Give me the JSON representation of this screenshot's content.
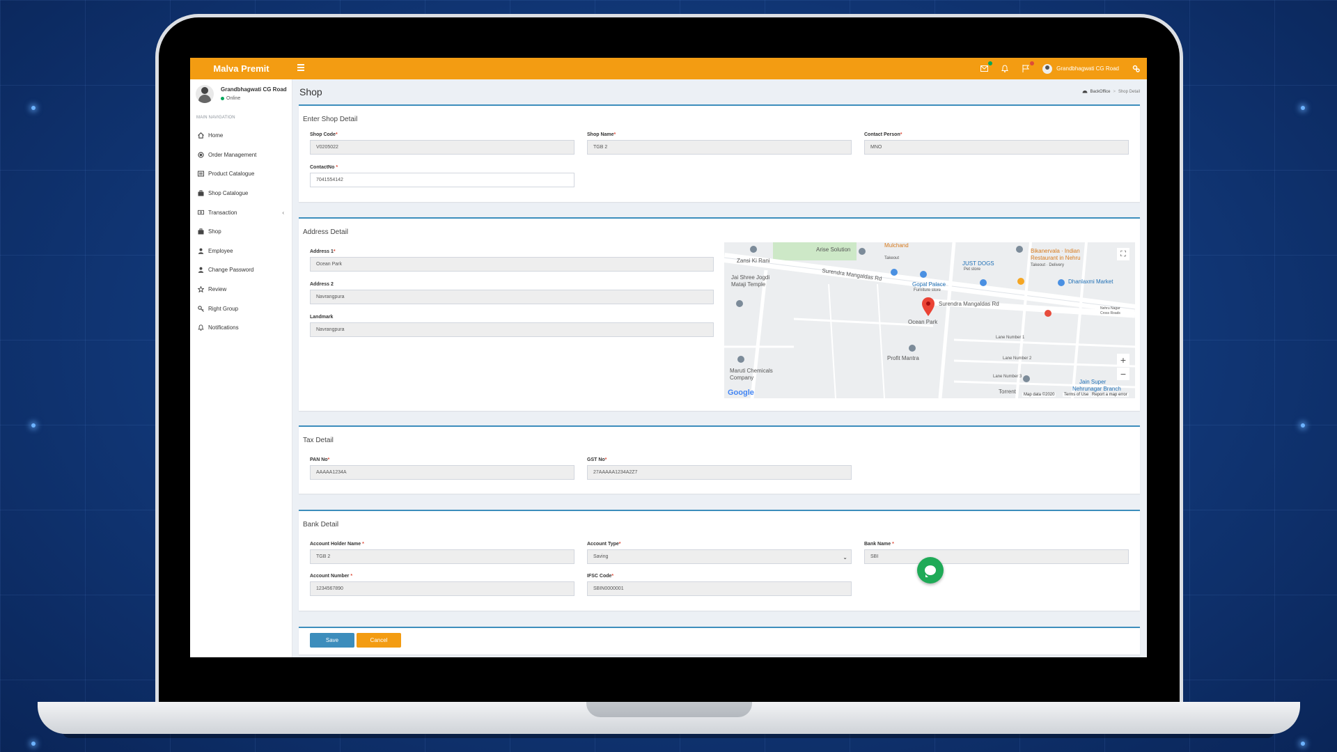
{
  "app": {
    "brand": "Malva Premit"
  },
  "topbar": {
    "username": "Grandbhagwati CG Road",
    "icons": [
      "mail-icon",
      "bell-icon",
      "flag-icon",
      "avatar",
      "gears-icon"
    ],
    "badge_colors": {
      "mail": "#00a65a",
      "flag": "#dd4b39"
    }
  },
  "sidebar": {
    "user_name": "Grandbhagwati CG Road",
    "user_status": "Online",
    "nav_header": "MAIN NAVIGATION",
    "items": [
      {
        "label": "Home",
        "icon": "home-icon"
      },
      {
        "label": "Order Management",
        "icon": "circle-icon"
      },
      {
        "label": "Product Catalogue",
        "icon": "list-icon"
      },
      {
        "label": "Shop Catalogue",
        "icon": "briefcase-icon"
      },
      {
        "label": "Transaction",
        "icon": "money-icon"
      },
      {
        "label": "Shop",
        "icon": "briefcase-icon"
      },
      {
        "label": "Employee",
        "icon": "user-icon"
      },
      {
        "label": "Change Password",
        "icon": "user-icon"
      },
      {
        "label": "Review",
        "icon": "star-icon"
      },
      {
        "label": "Right Group",
        "icon": "key-icon"
      },
      {
        "label": "Notifications",
        "icon": "bell-icon"
      }
    ]
  },
  "page": {
    "title": "Shop",
    "breadcrumb": [
      "BackOffice",
      "Shop Detail"
    ]
  },
  "shop_detail": {
    "title": "Enter Shop Detail",
    "shop_code": {
      "label": "Shop Code",
      "value": "V0205022"
    },
    "shop_name": {
      "label": "Shop Name",
      "value": "TGB 2"
    },
    "contact_person": {
      "label": "Contact Person",
      "value": "MNO"
    },
    "contact_no": {
      "label": "ContactNo ",
      "value": "7041554142"
    }
  },
  "address_detail": {
    "title": "Address Detail",
    "address1": {
      "label": "Address 1",
      "value": "Ocean Park"
    },
    "address2": {
      "label": "Address 2",
      "value": "Navrangpura"
    },
    "landmark": {
      "label": "Landmark",
      "value": "Navrangpura"
    }
  },
  "map": {
    "labels": {
      "zansi": "Zansi Ki Rani",
      "arise": "Arise Solution",
      "mulchand": "Mulchand",
      "takeout": "Takeout",
      "just_dogs": "JUST DOGS",
      "pet_store": "Pet store",
      "bikanervala": "Bikanervala · Indian",
      "bikanervala2": "Restaurant in Nehru",
      "bikanervala3": "Takeout · Delivery",
      "jai_shree": "Jai Shree Jogdi",
      "jai_shree2": "Mataji Temple",
      "surendra1": "Surendra Mangaldas Rd",
      "gopal": "Gopal Palace",
      "furniture": "Furniture store",
      "dhanlaxmi": "Dhanlaxmi Market",
      "surendra2": "Surendra Mangaldas Rd",
      "nehru_nagar": "Nehru Nagar",
      "cross_roads": "Cross Roads",
      "ocean_park": "Ocean Park",
      "lane1": "Lane Number 1",
      "profit": "Profit Mantra",
      "lane2": "Lane Number 2",
      "maruti": "Maruti Chemicals",
      "company": "Company",
      "lane3": "Lane Number 3",
      "jain": "Jain Super",
      "nehrunagar": "Nehrunagar Branch",
      "torrent": "Torrent",
      "google": "Google",
      "map_data": "Map data ©2020",
      "terms": "Terms of Use",
      "report": "Report a map error"
    },
    "controls": {
      "zoom_in": "+",
      "zoom_out": "−",
      "fullscreen": "⛶"
    }
  },
  "tax_detail": {
    "title": "Tax Detail",
    "pan": {
      "label": "PAN No",
      "value": "AAAAA1234A"
    },
    "gst": {
      "label": "GST No",
      "value": "27AAAAA1234A2Z7"
    }
  },
  "bank_detail": {
    "title": "Bank Detail",
    "holder": {
      "label": "Account Holder Name ",
      "value": "TGB 2"
    },
    "type": {
      "label": "Account Type",
      "value": "Saving"
    },
    "bank": {
      "label": "Bank Name ",
      "value": "SBI"
    },
    "number": {
      "label": "Account Number ",
      "value": "1234567890"
    },
    "ifsc": {
      "label": "IFSC Code",
      "value": "SBIN0000001"
    }
  },
  "actions": {
    "save": "Save",
    "cancel": "Cancel"
  },
  "colors": {
    "primary": "#3c8dbc",
    "orange": "#f39c12",
    "chat": "#1faa57",
    "required": "#dd4b39"
  }
}
